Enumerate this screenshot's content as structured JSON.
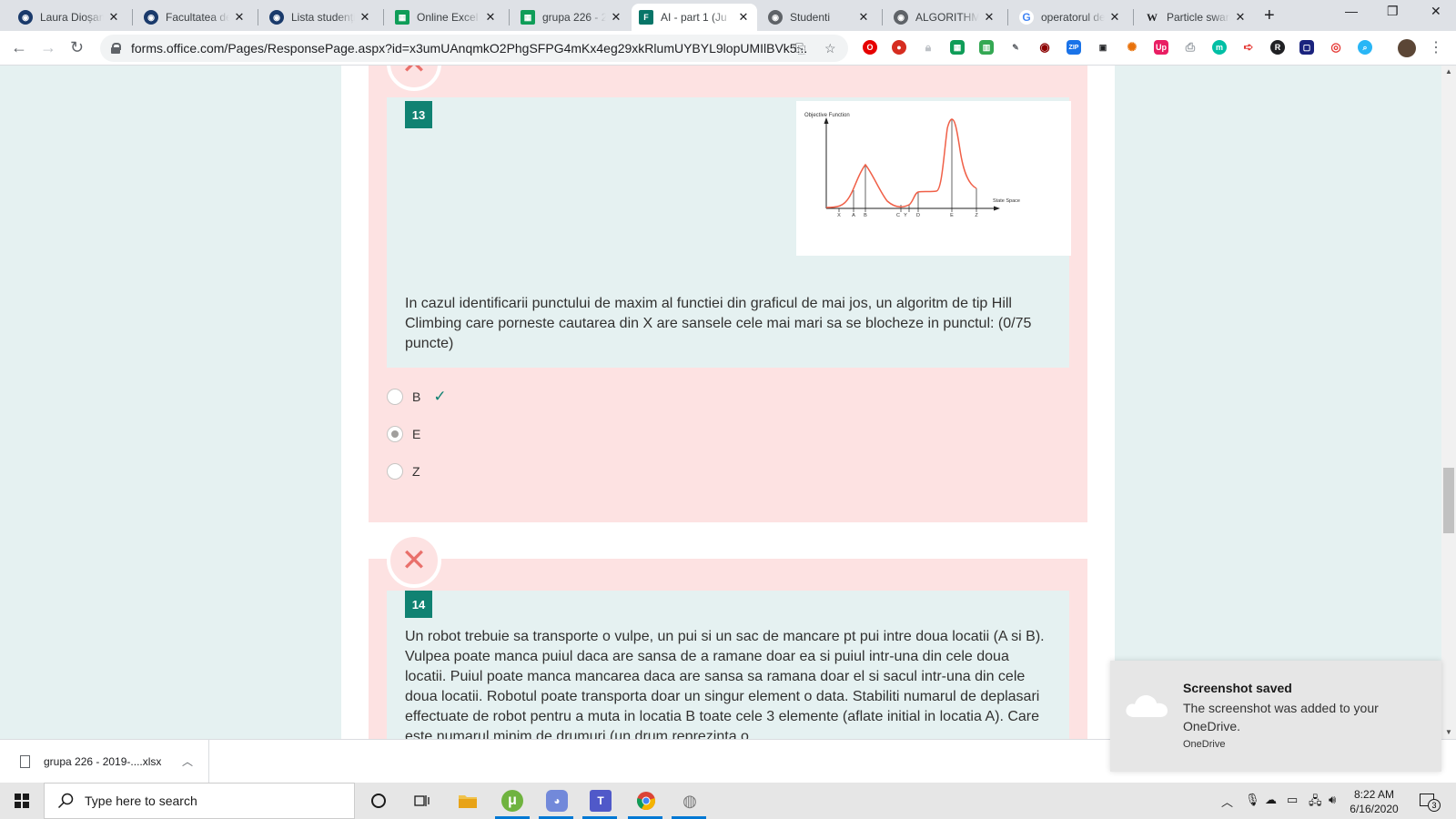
{
  "browser": {
    "tabs": [
      {
        "title": "Laura Dioșan",
        "icon": "globe-icon",
        "color": "#1a3a6b"
      },
      {
        "title": "Facultatea de",
        "icon": "globe-icon",
        "color": "#1a3a6b"
      },
      {
        "title": "Lista studenți",
        "icon": "globe-icon",
        "color": "#1a3a6b"
      },
      {
        "title": "Online Excel",
        "icon": "sheets-icon",
        "color": "#0f9d58"
      },
      {
        "title": "grupa 226 - 2",
        "icon": "sheets-icon",
        "color": "#0f9d58"
      },
      {
        "title": "AI - part 1 (Ju",
        "icon": "forms-icon",
        "color": "#077568"
      },
      {
        "title": "Studenti",
        "icon": "globe-icon",
        "color": "#5f6368"
      },
      {
        "title": "ALGORITHMIC",
        "icon": "globe-icon",
        "color": "#5f6368"
      },
      {
        "title": "operatorul de",
        "icon": "google-icon",
        "color": "#4285f4"
      },
      {
        "title": "Particle swarm",
        "icon": "wikipedia-icon",
        "color": "#202124"
      }
    ],
    "new_tab": "+",
    "address": "forms.office.com/Pages/ResponsePage.aspx?id=x3umUAnqmkO2PhgSFPG4mKx4eg29xkRlumUYBYL9lopUMIlBVk5..."
  },
  "questions": [
    {
      "number": "13",
      "status": "incorrect",
      "text": "In cazul identificarii punctului de maxim al functiei din graficul de mai jos, un algoritm de tip Hill Climbing care porneste cautarea din X are sansele cele mai mari sa se blocheze in punctul: (0/75 puncte)",
      "figure": {
        "title": "Objective Function",
        "xlabel": "State Space",
        "ticks": [
          "X",
          "A",
          "B",
          "C",
          "Y",
          "D",
          "E",
          "Z"
        ]
      },
      "options": [
        {
          "label": "B",
          "selected": false,
          "correct": true
        },
        {
          "label": "E",
          "selected": true,
          "correct": false
        },
        {
          "label": "Z",
          "selected": false,
          "correct": false
        }
      ]
    },
    {
      "number": "14",
      "status": "incorrect",
      "text": "Un robot trebuie sa transporte o vulpe, un pui si un sac de mancare pt pui intre doua locatii (A si B). Vulpea poate manca puiul daca are sansa de a ramane doar ea si puiul intr-una din cele doua locatii. Puiul poate manca mancarea daca are sansa sa ramana doar el si sacul intr-una din cele doua locatii. Robotul poate transporta doar un singur element o data. Stabiliti numarul de deplasari effectuate de robot pentru a muta in locatia B toate cele 3 elemente (aflate initial in locatia A). Care este numarul minim de drumuri (un drum reprezinta o"
    }
  ],
  "download": {
    "filename": "grupa 226 - 2019-....xlsx"
  },
  "toast": {
    "title": "Screenshot saved",
    "message": "The screenshot was added to your OneDrive.",
    "source": "OneDrive"
  },
  "taskbar": {
    "search_placeholder": "Type here to search",
    "time": "8:22 AM",
    "date": "6/16/2020",
    "notification_count": "3"
  }
}
